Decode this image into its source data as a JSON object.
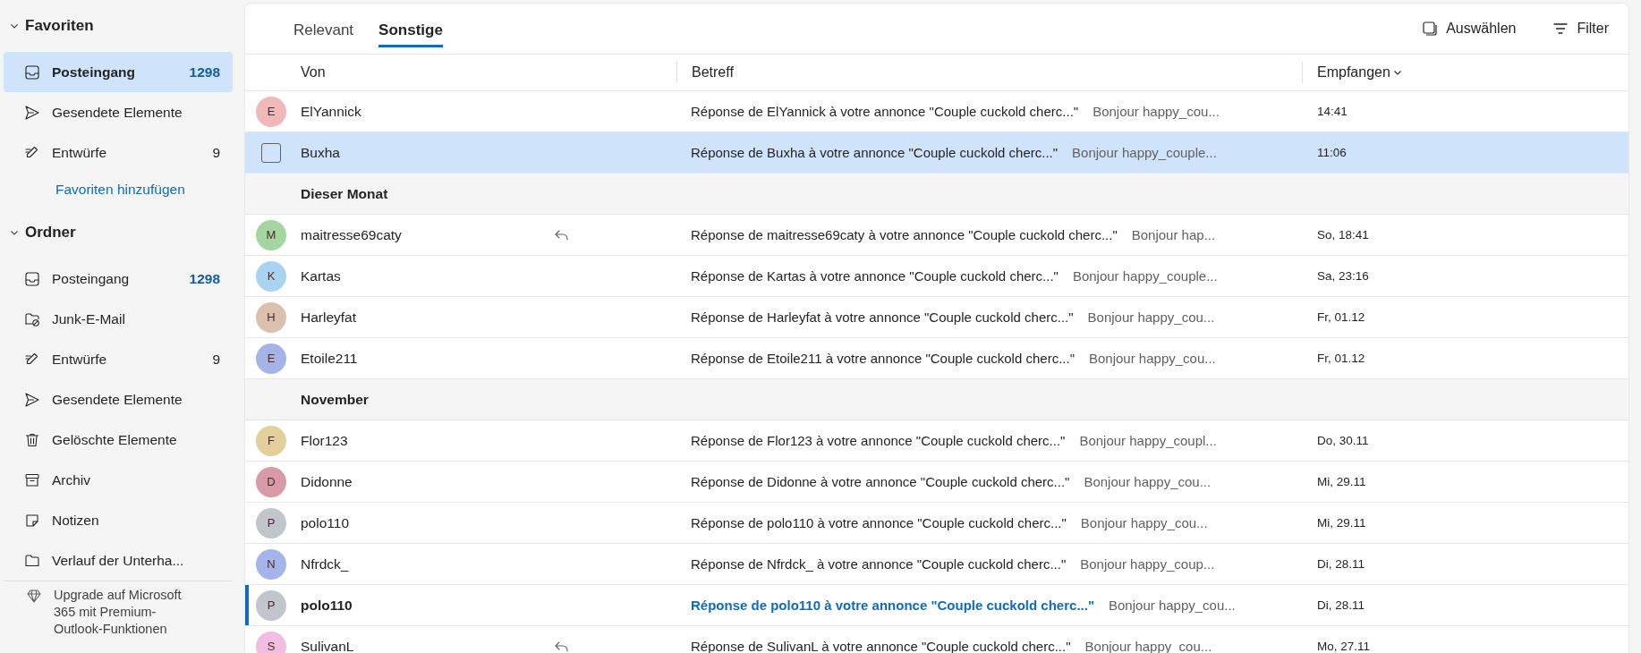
{
  "sidebar": {
    "sections": [
      {
        "title": "Favoriten",
        "expanded": true,
        "items": [
          {
            "kind": "inbox",
            "label": "Posteingang",
            "count": "1298",
            "count_unread": true,
            "selected": true
          },
          {
            "kind": "send",
            "label": "Gesendete Elemente",
            "selected": false
          },
          {
            "kind": "draft",
            "label": "Entwürfe",
            "count": "9",
            "count_unread": false,
            "selected": false
          }
        ],
        "link": "Favoriten hinzufügen"
      },
      {
        "title": "Ordner",
        "expanded": true,
        "items": [
          {
            "kind": "inbox",
            "label": "Posteingang",
            "count": "1298",
            "count_unread": true,
            "selected": false
          },
          {
            "kind": "junk",
            "label": "Junk-E-Mail",
            "selected": false
          },
          {
            "kind": "draft",
            "label": "Entwürfe",
            "count": "9",
            "count_unread": false,
            "selected": false
          },
          {
            "kind": "send",
            "label": "Gesendete Elemente",
            "selected": false
          },
          {
            "kind": "trash",
            "label": "Gelöschte Elemente",
            "selected": false
          },
          {
            "kind": "archive",
            "label": "Archiv",
            "selected": false
          },
          {
            "kind": "note",
            "label": "Notizen",
            "selected": false
          },
          {
            "kind": "folder",
            "label": "Verlauf der Unterha...",
            "selected": false
          }
        ]
      }
    ],
    "upgrade": "Upgrade auf Microsoft 365 mit Premium-Outlook-Funktionen"
  },
  "tabs": [
    {
      "label": "Relevant",
      "selected": false
    },
    {
      "label": "Sonstige",
      "selected": true
    }
  ],
  "toolbar": {
    "select": "Auswählen",
    "filter": "Filter"
  },
  "columns": [
    {
      "label": "Von"
    },
    {
      "label": "Betreff"
    },
    {
      "label": "Empfangen",
      "sorted": true
    }
  ],
  "messages": [
    {
      "kind": "message",
      "sender": "ElYannick",
      "initial": "E",
      "color": "#f0b8b8",
      "subject": "Réponse de ElYannick à votre annonce \"Couple cuckold cherc...\"",
      "preview": "Bonjour happy_cou...",
      "received": "14:41",
      "selected": false,
      "unread": false,
      "replied": false
    },
    {
      "kind": "message",
      "sender": "Buxha",
      "subject": "Réponse de Buxha à votre annonce \"Couple cuckold cherc...\"",
      "preview": "Bonjour happy_couple...",
      "received": "11:06",
      "selected": true,
      "unread": false,
      "replied": false
    },
    {
      "kind": "group",
      "label": "Dieser Monat"
    },
    {
      "kind": "message",
      "sender": "maitresse69caty",
      "initial": "M",
      "color": "#a3d6a0",
      "subject": "Réponse de maitresse69caty à votre annonce \"Couple cuckold cherc...\"",
      "preview": "Bonjour hap...",
      "received": "So, 18:41",
      "selected": false,
      "unread": false,
      "replied": true
    },
    {
      "kind": "message",
      "sender": "Kartas",
      "initial": "K",
      "color": "#a9d3f0",
      "subject": "Réponse de Kartas à votre annonce \"Couple cuckold cherc...\"",
      "preview": "Bonjour happy_couple...",
      "received": "Sa, 23:16",
      "selected": false,
      "unread": false,
      "replied": false
    },
    {
      "kind": "message",
      "sender": "Harleyfat",
      "initial": "H",
      "color": "#dcc0ae",
      "subject": "Réponse de Harleyfat à votre annonce \"Couple cuckold cherc...\"",
      "preview": "Bonjour happy_cou...",
      "received": "Fr, 01.12",
      "selected": false,
      "unread": false,
      "replied": false
    },
    {
      "kind": "message",
      "sender": "Etoile211",
      "initial": "E",
      "color": "#a5b4e8",
      "subject": "Réponse de Etoile211 à votre annonce \"Couple cuckold cherc...\"",
      "preview": "Bonjour happy_cou...",
      "received": "Fr, 01.12",
      "selected": false,
      "unread": false,
      "replied": false
    },
    {
      "kind": "group",
      "label": "November"
    },
    {
      "kind": "message",
      "sender": "Flor123",
      "initial": "F",
      "color": "#e3cf99",
      "subject": "Réponse de Flor123 à votre annonce \"Couple cuckold cherc...\"",
      "preview": "Bonjour happy_coupl...",
      "received": "Do, 30.11",
      "selected": false,
      "unread": false,
      "replied": false
    },
    {
      "kind": "message",
      "sender": "Didonne",
      "initial": "D",
      "color": "#d79aa6",
      "subject": "Réponse de Didonne à votre annonce \"Couple cuckold cherc...\"",
      "preview": "Bonjour happy_cou...",
      "received": "Mi, 29.11",
      "selected": false,
      "unread": false,
      "replied": false
    },
    {
      "kind": "message",
      "sender": "polo110",
      "initial": "P",
      "color": "#c0c6cc",
      "subject": "Réponse de polo110 à votre annonce \"Couple cuckold cherc...\"",
      "preview": "Bonjour happy_cou...",
      "received": "Mi, 29.11",
      "selected": false,
      "unread": false,
      "replied": false
    },
    {
      "kind": "message",
      "sender": "Nfrdck_",
      "initial": "N",
      "color": "#a5b4ea",
      "subject": "Réponse de Nfrdck_ à votre annonce \"Couple cuckold cherc...\"",
      "preview": "Bonjour happy_coup...",
      "received": "Di, 28.11",
      "selected": false,
      "unread": false,
      "replied": false
    },
    {
      "kind": "message",
      "sender": "polo110",
      "initial": "P",
      "color": "#c0c6cc",
      "subject": "Réponse de polo110 à votre annonce \"Couple cuckold cherc...\"",
      "preview": "Bonjour happy_cou...",
      "received": "Di, 28.11",
      "selected": false,
      "unread": true,
      "replied": false
    },
    {
      "kind": "message",
      "sender": "SulivanL",
      "initial": "S",
      "color": "#f1bde0",
      "subject": "Réponse de SulivanL à votre annonce \"Couple cuckold cherc...\"",
      "preview": "Bonjour happy_cou...",
      "received": "Mo, 27.11",
      "selected": false,
      "unread": false,
      "replied": true
    }
  ]
}
